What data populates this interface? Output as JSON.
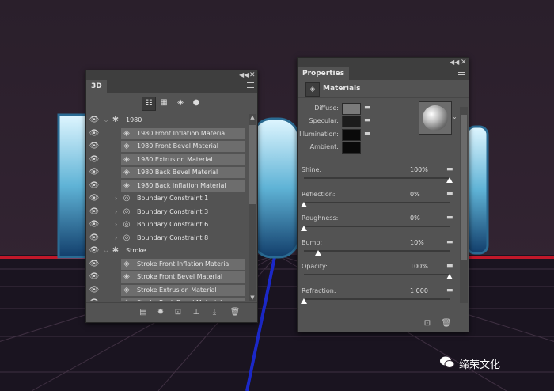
{
  "panel_3d": {
    "collapse_icon": "double-chevron-left-icon",
    "close_icon": "close-icon",
    "tab_label": "3D",
    "menu_icon": "panel-menu-icon",
    "toolbar": [
      {
        "icon": "scene-filter-icon",
        "active": true
      },
      {
        "icon": "mesh-filter-icon",
        "active": false
      },
      {
        "icon": "material-filter-icon",
        "active": false
      },
      {
        "icon": "light-filter-icon",
        "active": false
      }
    ],
    "layers": [
      {
        "label": "1980",
        "type": "group",
        "expanded": true,
        "indent": 0,
        "material": false
      },
      {
        "label": "1980 Front Inflation Material",
        "type": "material",
        "indent": 1,
        "material": true
      },
      {
        "label": "1980 Front Bevel Material",
        "type": "material",
        "indent": 1,
        "material": true
      },
      {
        "label": "1980 Extrusion Material",
        "type": "material",
        "indent": 1,
        "material": true
      },
      {
        "label": "1980 Back Bevel Material",
        "type": "material",
        "indent": 1,
        "material": true
      },
      {
        "label": "1980 Back Inflation Material",
        "type": "material",
        "indent": 1,
        "material": true
      },
      {
        "label": "Boundary Constraint 1",
        "type": "constraint",
        "indent": 1,
        "material": false
      },
      {
        "label": "Boundary Constraint 3",
        "type": "constraint",
        "indent": 1,
        "material": false
      },
      {
        "label": "Boundary Constraint 6",
        "type": "constraint",
        "indent": 1,
        "material": false
      },
      {
        "label": "Boundary Constraint 8",
        "type": "constraint",
        "indent": 1,
        "material": false
      },
      {
        "label": "Stroke",
        "type": "group",
        "expanded": true,
        "indent": 0,
        "material": false
      },
      {
        "label": "Stroke Front Inflation Material",
        "type": "material",
        "indent": 1,
        "material": true
      },
      {
        "label": "Stroke Front Bevel Material",
        "type": "material",
        "indent": 1,
        "material": true
      },
      {
        "label": "Stroke Extrusion Material",
        "type": "material",
        "indent": 1,
        "material": true
      },
      {
        "label": "Stroke Back Bevel Material",
        "type": "material",
        "indent": 1,
        "material": true
      }
    ],
    "bottom_buttons": [
      {
        "icon": "mesh-icon"
      },
      {
        "icon": "add-light-icon"
      },
      {
        "icon": "render-icon"
      },
      {
        "icon": "ground-icon"
      },
      {
        "icon": "move-to-ground-icon"
      },
      {
        "icon": "delete-icon"
      }
    ]
  },
  "panel_properties": {
    "tab_label": "Properties",
    "section_title": "Materials",
    "swatches": [
      {
        "label": "Diffuse:",
        "color": "#7a7a7a",
        "folder": true
      },
      {
        "label": "Specular:",
        "color": "#1c1c1c",
        "folder": true
      },
      {
        "label": "Illumination:",
        "color": "#0a0a0a",
        "folder": true
      },
      {
        "label": "Ambient:",
        "color": "#0a0a0a",
        "folder": false
      }
    ],
    "sliders": [
      {
        "label": "Shine:",
        "value": "100%",
        "fraction": 1.0
      },
      {
        "label": "Reflection:",
        "value": "0%",
        "fraction": 0.0
      },
      {
        "label": "Roughness:",
        "value": "0%",
        "fraction": 0.0
      },
      {
        "label": "Bump:",
        "value": "10%",
        "fraction": 0.1
      },
      {
        "label": "Opacity:",
        "value": "100%",
        "fraction": 1.0
      },
      {
        "label": "Refraction:",
        "value": "1.000",
        "fraction": 0.0
      }
    ],
    "bottom_buttons": [
      {
        "icon": "new-material-icon"
      },
      {
        "icon": "delete-icon"
      }
    ]
  },
  "watermark": {
    "text": "缔荣文化"
  }
}
